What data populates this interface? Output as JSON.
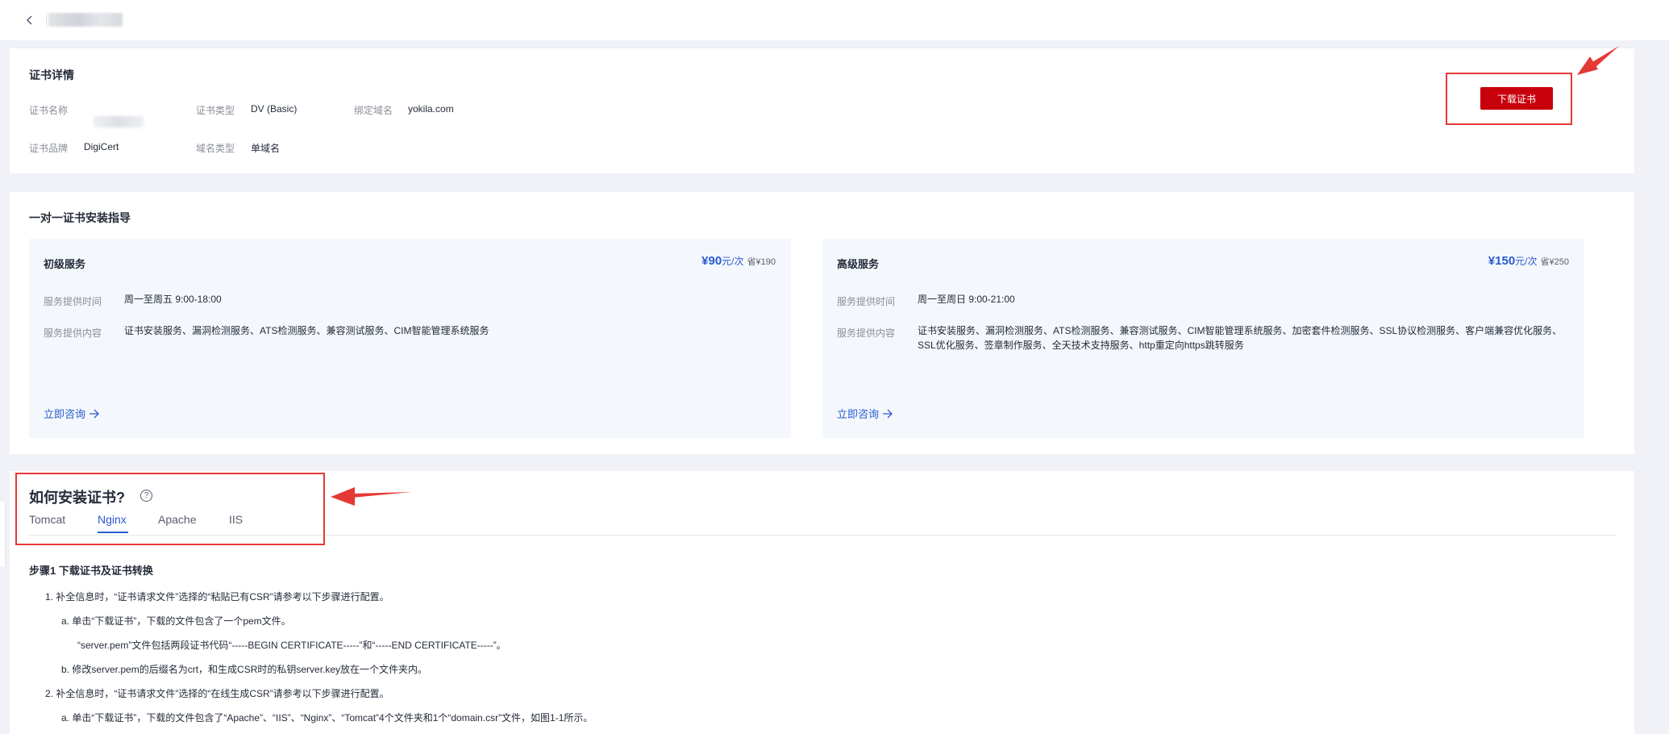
{
  "detail": {
    "title": "证书详情",
    "fields": [
      {
        "label": "证书名称",
        "value": ""
      },
      {
        "label": "证书类型",
        "value": "DV (Basic)"
      },
      {
        "label": "绑定域名",
        "value": "yokila.com"
      },
      {
        "label": "证书品牌",
        "value": "DigiCert"
      },
      {
        "label": "域名类型",
        "value": "单域名"
      }
    ],
    "download_label": "下载证书"
  },
  "guide": {
    "title": "一对一证书安装指导",
    "services": [
      {
        "name": "初级服务",
        "price": "¥90",
        "unit": "元/次",
        "original": "¥190",
        "time_label": "服务提供时间",
        "time": "周一至周五 9:00-18:00",
        "content_label": "服务提供内容",
        "content": "证书安装服务、漏洞检测服务、ATS检测服务、兼容测试服务、CIM智能管理系统服务",
        "consult": "立即咨询"
      },
      {
        "name": "高级服务",
        "price": "¥150",
        "unit": "元/次",
        "original": "¥250",
        "time_label": "服务提供时间",
        "time": "周一至周日 9:00-21:00",
        "content_label": "服务提供内容",
        "content": "证书安装服务、漏洞检测服务、ATS检测服务、兼容测试服务、CIM智能管理系统服务、加密套件检测服务、SSL协议检测服务、客户端兼容优化服务、SSL优化服务、签章制作服务、全天技术支持服务、http重定向https跳转服务",
        "consult": "立即咨询"
      }
    ]
  },
  "install": {
    "title": "如何安装证书?",
    "help_icon": "question-circle-icon",
    "tabs": [
      "Tomcat",
      "Nginx",
      "Apache",
      "IIS"
    ],
    "active_tab": "Nginx",
    "step_title": "步骤1 下载证书及证书转换",
    "lines": [
      "1. 补全信息时，“证书请求文件”选择的“粘贴已有CSR”请参考以下步骤进行配置。",
      "a. 单击“下载证书”，下载的文件包含了一个pem文件。",
      "“server.pem”文件包括两段证书代码“-----BEGIN CERTIFICATE-----”和“-----END CERTIFICATE-----”。",
      "b. 修改server.pem的后缀名为crt，和生成CSR时的私钥server.key放在一个文件夹内。",
      "2. 补全信息时，“证书请求文件”选择的“在线生成CSR”请参考以下步骤进行配置。",
      "a. 单击“下载证书”，下载的文件包含了“Apache”、“IIS”、“Nginx”、“Tomcat”4个文件夹和1个“domain.csr”文件，如图1-1所示。"
    ]
  },
  "colors": {
    "accent": "#2a5ad2",
    "primary_button": "#c7000b",
    "annotation": "#e53935"
  }
}
